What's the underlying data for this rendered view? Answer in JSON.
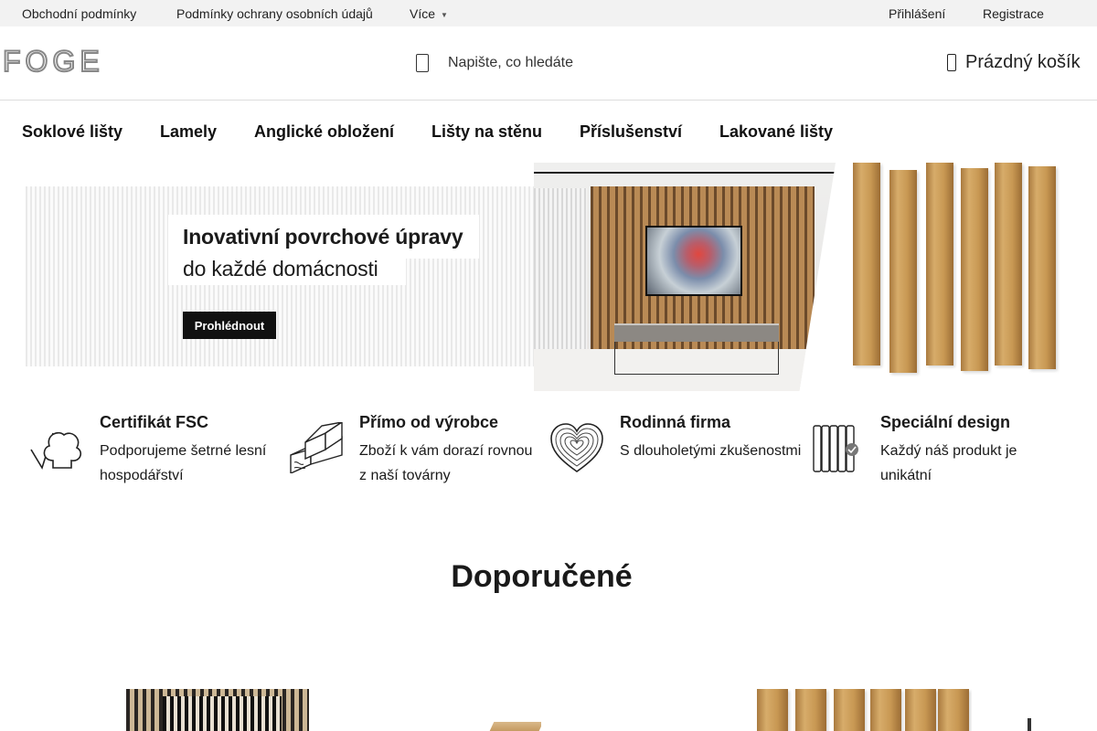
{
  "topbar": {
    "links": [
      "Obchodní podmínky",
      "Podmínky ochrany osobních údajů",
      "Více"
    ],
    "more_caret": "▼",
    "login": "Přihlášení",
    "register": "Registrace"
  },
  "header": {
    "logo_text": "FOGE",
    "search_placeholder": "Napište, co hledáte",
    "cart_label": "Prázdný košík"
  },
  "nav": {
    "items": [
      "Soklové lišty",
      "Lamely",
      "Anglické obložení",
      "Lišty na stěnu",
      "Příslušenství",
      "Lakované lišty"
    ]
  },
  "hero": {
    "title": "Inovativní povrchové úpravy",
    "subtitle": "do každé domácnosti",
    "button": "Prohlédnout"
  },
  "features": [
    {
      "icon": "tree-check-icon",
      "title": "Certifikát FSC",
      "text": "Podporujeme šetrné lesní hospodářství"
    },
    {
      "icon": "wood-beams-icon",
      "title": "Přímo od výrobce",
      "text": "Zboží k vám dorazí rovnou z naší továrny"
    },
    {
      "icon": "heart-rings-icon",
      "title": "Rodinná firma",
      "text": "S dlouholetými zkušenostmi"
    },
    {
      "icon": "panel-check-icon",
      "title": "Speciální design",
      "text": "Každý náš produkt je unikátní"
    }
  ],
  "recommended": {
    "title": "Doporučené"
  },
  "colors": {
    "topbar_bg": "#f2f2f2",
    "logo": "#888888",
    "text": "#1a1a1a",
    "wood": "#c89853"
  }
}
